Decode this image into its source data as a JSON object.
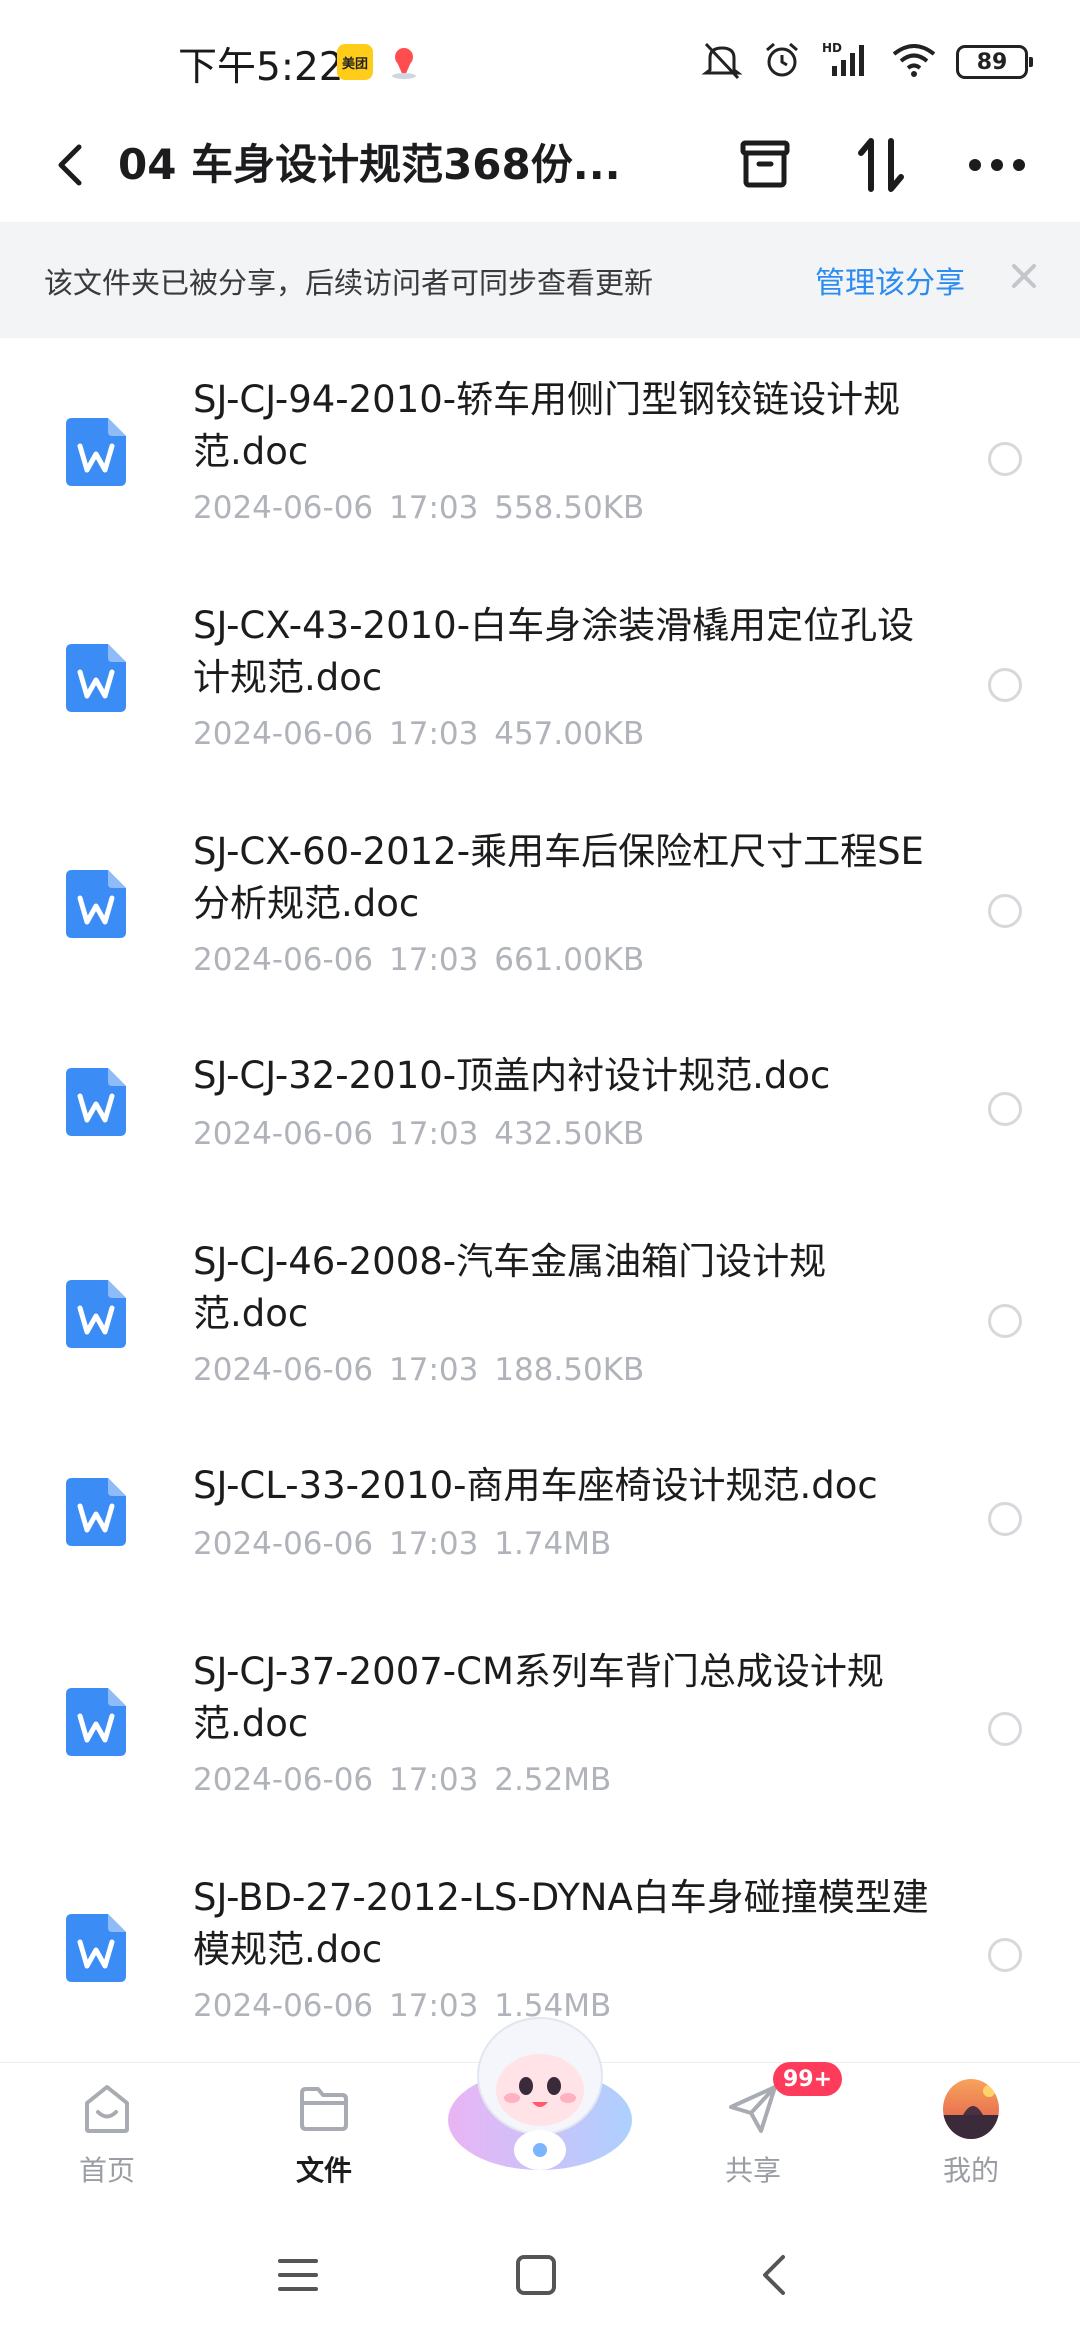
{
  "status_bar": {
    "time": "下午5:22",
    "meituan_badge": "美团",
    "battery": "89",
    "hd_label": "HD"
  },
  "header": {
    "title": "04 车身设计规范368份...",
    "icons": [
      "chevron-left-icon",
      "archive-icon",
      "sort-icon",
      "more-icon"
    ]
  },
  "share_banner": {
    "text": "该文件夹已被分享，后续访问者可同步查看更新",
    "manage_label": "管理该分享"
  },
  "files": [
    {
      "name": "SJ-CJ-94-2010-轿车用侧门型钢铰链设计规范.doc",
      "date": "2024-06-06",
      "time": "17:03",
      "size": "558.50KB"
    },
    {
      "name": "SJ-CX-43-2010-白车身涂装滑橇用定位孔设计规范.doc",
      "date": "2024-06-06",
      "time": "17:03",
      "size": "457.00KB"
    },
    {
      "name": "SJ-CX-60-2012-乘用车后保险杠尺寸工程SE分析规范.doc",
      "date": "2024-06-06",
      "time": "17:03",
      "size": "661.00KB"
    },
    {
      "name": "SJ-CJ-32-2010-顶盖内衬设计规范.doc",
      "date": "2024-06-06",
      "time": "17:03",
      "size": "432.50KB"
    },
    {
      "name": "SJ-CJ-46-2008-汽车金属油箱门设计规范.doc",
      "date": "2024-06-06",
      "time": "17:03",
      "size": "188.50KB"
    },
    {
      "name": "SJ-CL-33-2010-商用车座椅设计规范.doc",
      "date": "2024-06-06",
      "time": "17:03",
      "size": "1.74MB"
    },
    {
      "name": "SJ-CJ-37-2007-CM系列车背门总成设计规范.doc",
      "date": "2024-06-06",
      "time": "17:03",
      "size": "2.52MB"
    },
    {
      "name": "SJ-BD-27-2012-LS-DYNA白车身碰撞模型建模规范.doc",
      "date": "2024-06-06",
      "time": "17:03",
      "size": "1.54MB"
    }
  ],
  "bottom_nav": {
    "items": [
      {
        "label": "首页",
        "icon": "home-icon"
      },
      {
        "label": "文件",
        "icon": "folder-icon"
      },
      {
        "label": "共享",
        "icon": "send-icon"
      },
      {
        "label": "我的",
        "icon": "avatar"
      }
    ],
    "share_badge": "99+"
  },
  "colors": {
    "accent": "#2d8cf0",
    "doc_icon": "#3b8cf5",
    "badge": "#ff3b5c"
  }
}
